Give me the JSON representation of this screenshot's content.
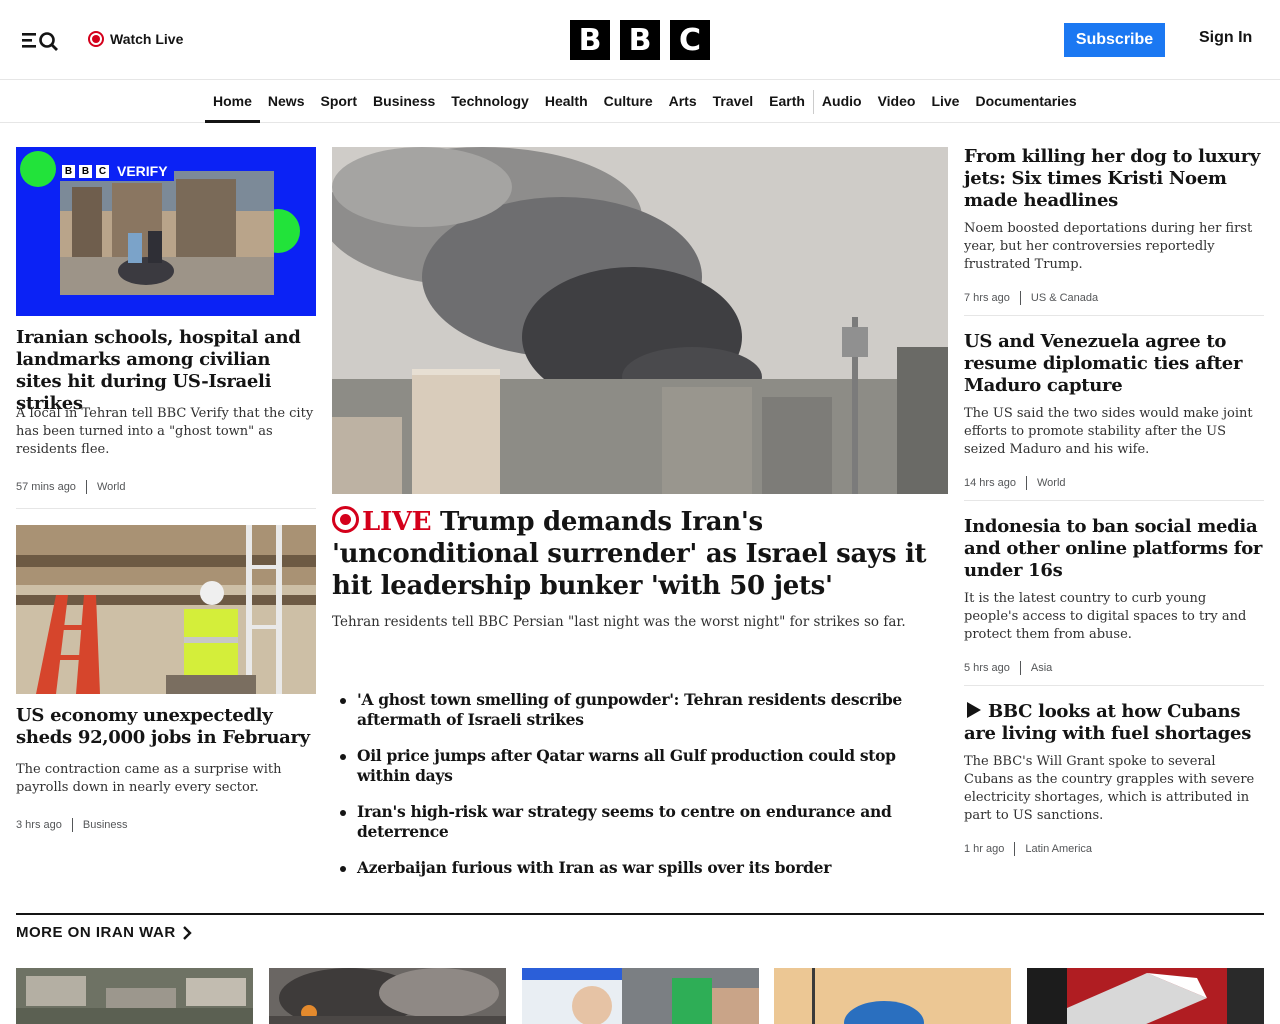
{
  "header": {
    "watch_live": "Watch Live",
    "logo_letters": [
      "B",
      "B",
      "C"
    ],
    "subscribe": "Subscribe",
    "sign_in": "Sign In"
  },
  "nav": {
    "items": [
      "Home",
      "News",
      "Sport",
      "Business",
      "Technology",
      "Health",
      "Culture",
      "Arts",
      "Travel",
      "Earth",
      "Audio",
      "Video",
      "Live",
      "Documentaries"
    ],
    "active": "Home"
  },
  "left": {
    "story1": {
      "image_badge": "VERIFY",
      "title": "Iranian schools, hospital and landmarks among civilian sites hit during US-Israeli strikes",
      "desc": "A local in Tehran tell BBC Verify that the city has been turned into a \"ghost town\" as residents flee.",
      "time": "57 mins ago",
      "section": "World"
    },
    "story2": {
      "title": "US economy unexpectedly sheds 92,000 jobs in February",
      "desc": "The contraction came as a surprise with payrolls down in nearly every sector.",
      "time": "3 hrs ago",
      "section": "Business"
    }
  },
  "center": {
    "live_label": "LIVE",
    "headline": "Trump demands Iran's 'unconditional surrender' as Israel says it hit leadership bunker 'with 50 jets'",
    "desc": "Tehran residents tell BBC Persian \"last night was the worst night\" for strikes so far.",
    "related": [
      "'A ghost town smelling of gunpowder': Tehran residents describe aftermath of Israeli strikes",
      "Oil price jumps after Qatar warns all Gulf production could stop within days",
      "Iran's high-risk war strategy seems to centre on endurance and deterrence",
      "Azerbaijan furious with Iran as war spills over its border"
    ]
  },
  "right": {
    "stories": [
      {
        "title": "From killing her dog to luxury jets: Six times Kristi Noem made headlines",
        "desc": "Noem boosted deportations during her first year, but her controversies reportedly frustrated Trump.",
        "time": "7 hrs ago",
        "section": "US & Canada"
      },
      {
        "title": "US and Venezuela agree to resume diplomatic ties after Maduro capture",
        "desc": "The US said the two sides would make joint efforts to promote stability after the US seized Maduro and his wife.",
        "time": "14 hrs ago",
        "section": "World"
      },
      {
        "title": "Indonesia to ban social media and other online platforms for under 16s",
        "desc": "It is the latest country to curb young people's access to digital spaces to try and protect them from abuse.",
        "time": "5 hrs ago",
        "section": "Asia"
      },
      {
        "title": "BBC looks at how Cubans are living with fuel shortages",
        "desc": "The BBC's Will Grant spoke to several Cubans as the country grapples with severe electricity shortages, which is attributed in part to US sanctions.",
        "time": "1 hr ago",
        "section": "Latin America"
      }
    ]
  },
  "more_section": {
    "title": "MORE ON IRAN WAR"
  },
  "colors": {
    "accent_blue": "#1b78f2",
    "live_red": "#d4001b",
    "text": "#141414"
  }
}
